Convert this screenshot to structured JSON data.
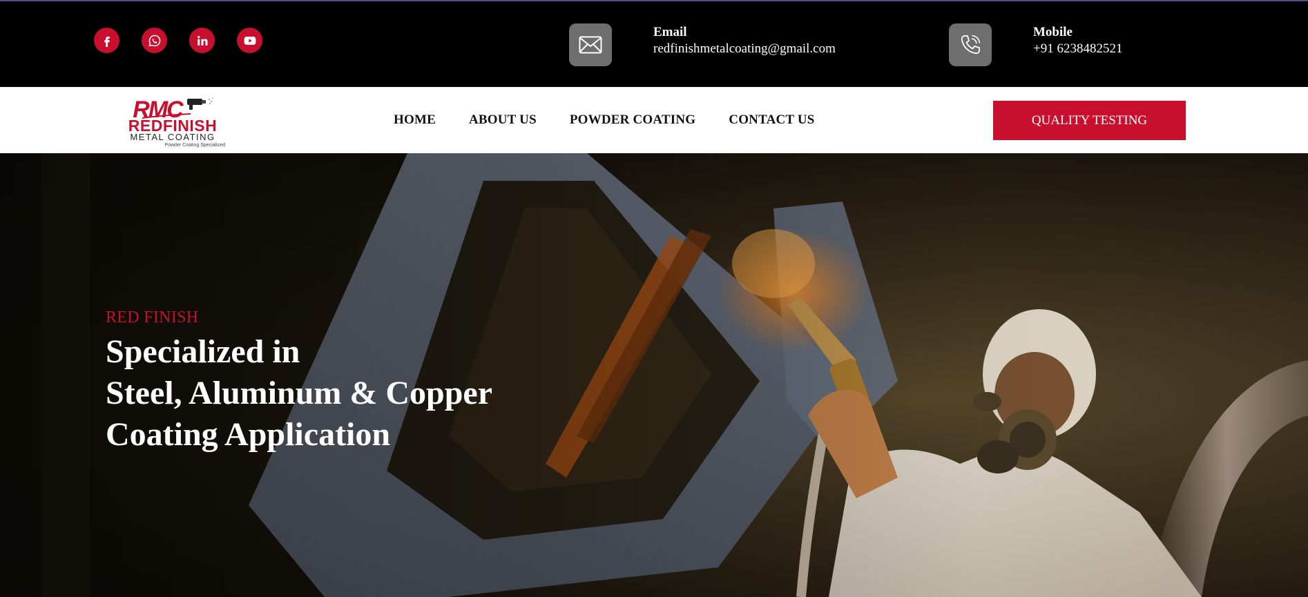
{
  "topbar": {
    "socials": [
      {
        "icon": "facebook-icon"
      },
      {
        "icon": "whatsapp-icon"
      },
      {
        "icon": "linkedin-icon"
      },
      {
        "icon": "youtube-icon"
      }
    ],
    "email": {
      "icon": "envelope-icon",
      "label": "Email",
      "value": "redfinishmetalcoating@gmail.com"
    },
    "mobile": {
      "icon": "phone-icon",
      "label": "Mobile",
      "value": "+91 6238482521"
    }
  },
  "logo": {
    "monogram": "RMC",
    "name": "REDFINISH",
    "subname": "METAL COATING",
    "tagline": "Powder Coating Specialized"
  },
  "nav": {
    "items": [
      {
        "label": "HOME"
      },
      {
        "label": "ABOUT US"
      },
      {
        "label": "POWDER COATING"
      },
      {
        "label": "CONTACT US"
      }
    ],
    "cta_label": "QUALITY TESTING"
  },
  "hero": {
    "eyebrow": "RED FINISH",
    "heading_lines": [
      "Specialized in",
      "Steel, Aluminum & Copper",
      "Coating Application"
    ]
  },
  "colors": {
    "accent": "#c8102e",
    "topbar_bg": "#000000",
    "icon_box": "#6e6e6e"
  }
}
